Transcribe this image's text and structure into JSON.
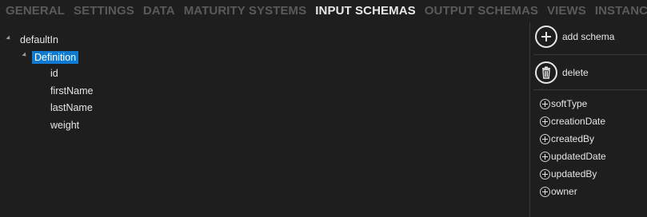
{
  "tabs": [
    {
      "label": "GENERAL",
      "active": false
    },
    {
      "label": "SETTINGS",
      "active": false
    },
    {
      "label": "DATA",
      "active": false
    },
    {
      "label": "MATURITY SYSTEMS",
      "active": false
    },
    {
      "label": "INPUT SCHEMAS",
      "active": true
    },
    {
      "label": "OUTPUT SCHEMAS",
      "active": false
    },
    {
      "label": "VIEWS",
      "active": false
    },
    {
      "label": "INSTANCES",
      "active": false
    }
  ],
  "tree": {
    "root": "defaultIn",
    "child": "Definition",
    "leaves": [
      "id",
      "firstName",
      "lastName",
      "weight"
    ]
  },
  "actions": {
    "add": "add schema",
    "delete": "delete"
  },
  "fields": [
    "softType",
    "creationDate",
    "createdBy",
    "updatedDate",
    "updatedBy",
    "owner"
  ],
  "colors": {
    "background": "#1e1e1e",
    "selection": "#0e7ad1",
    "inactive_tab": "#5a5a5a",
    "active_tab": "#e8e8e8"
  }
}
